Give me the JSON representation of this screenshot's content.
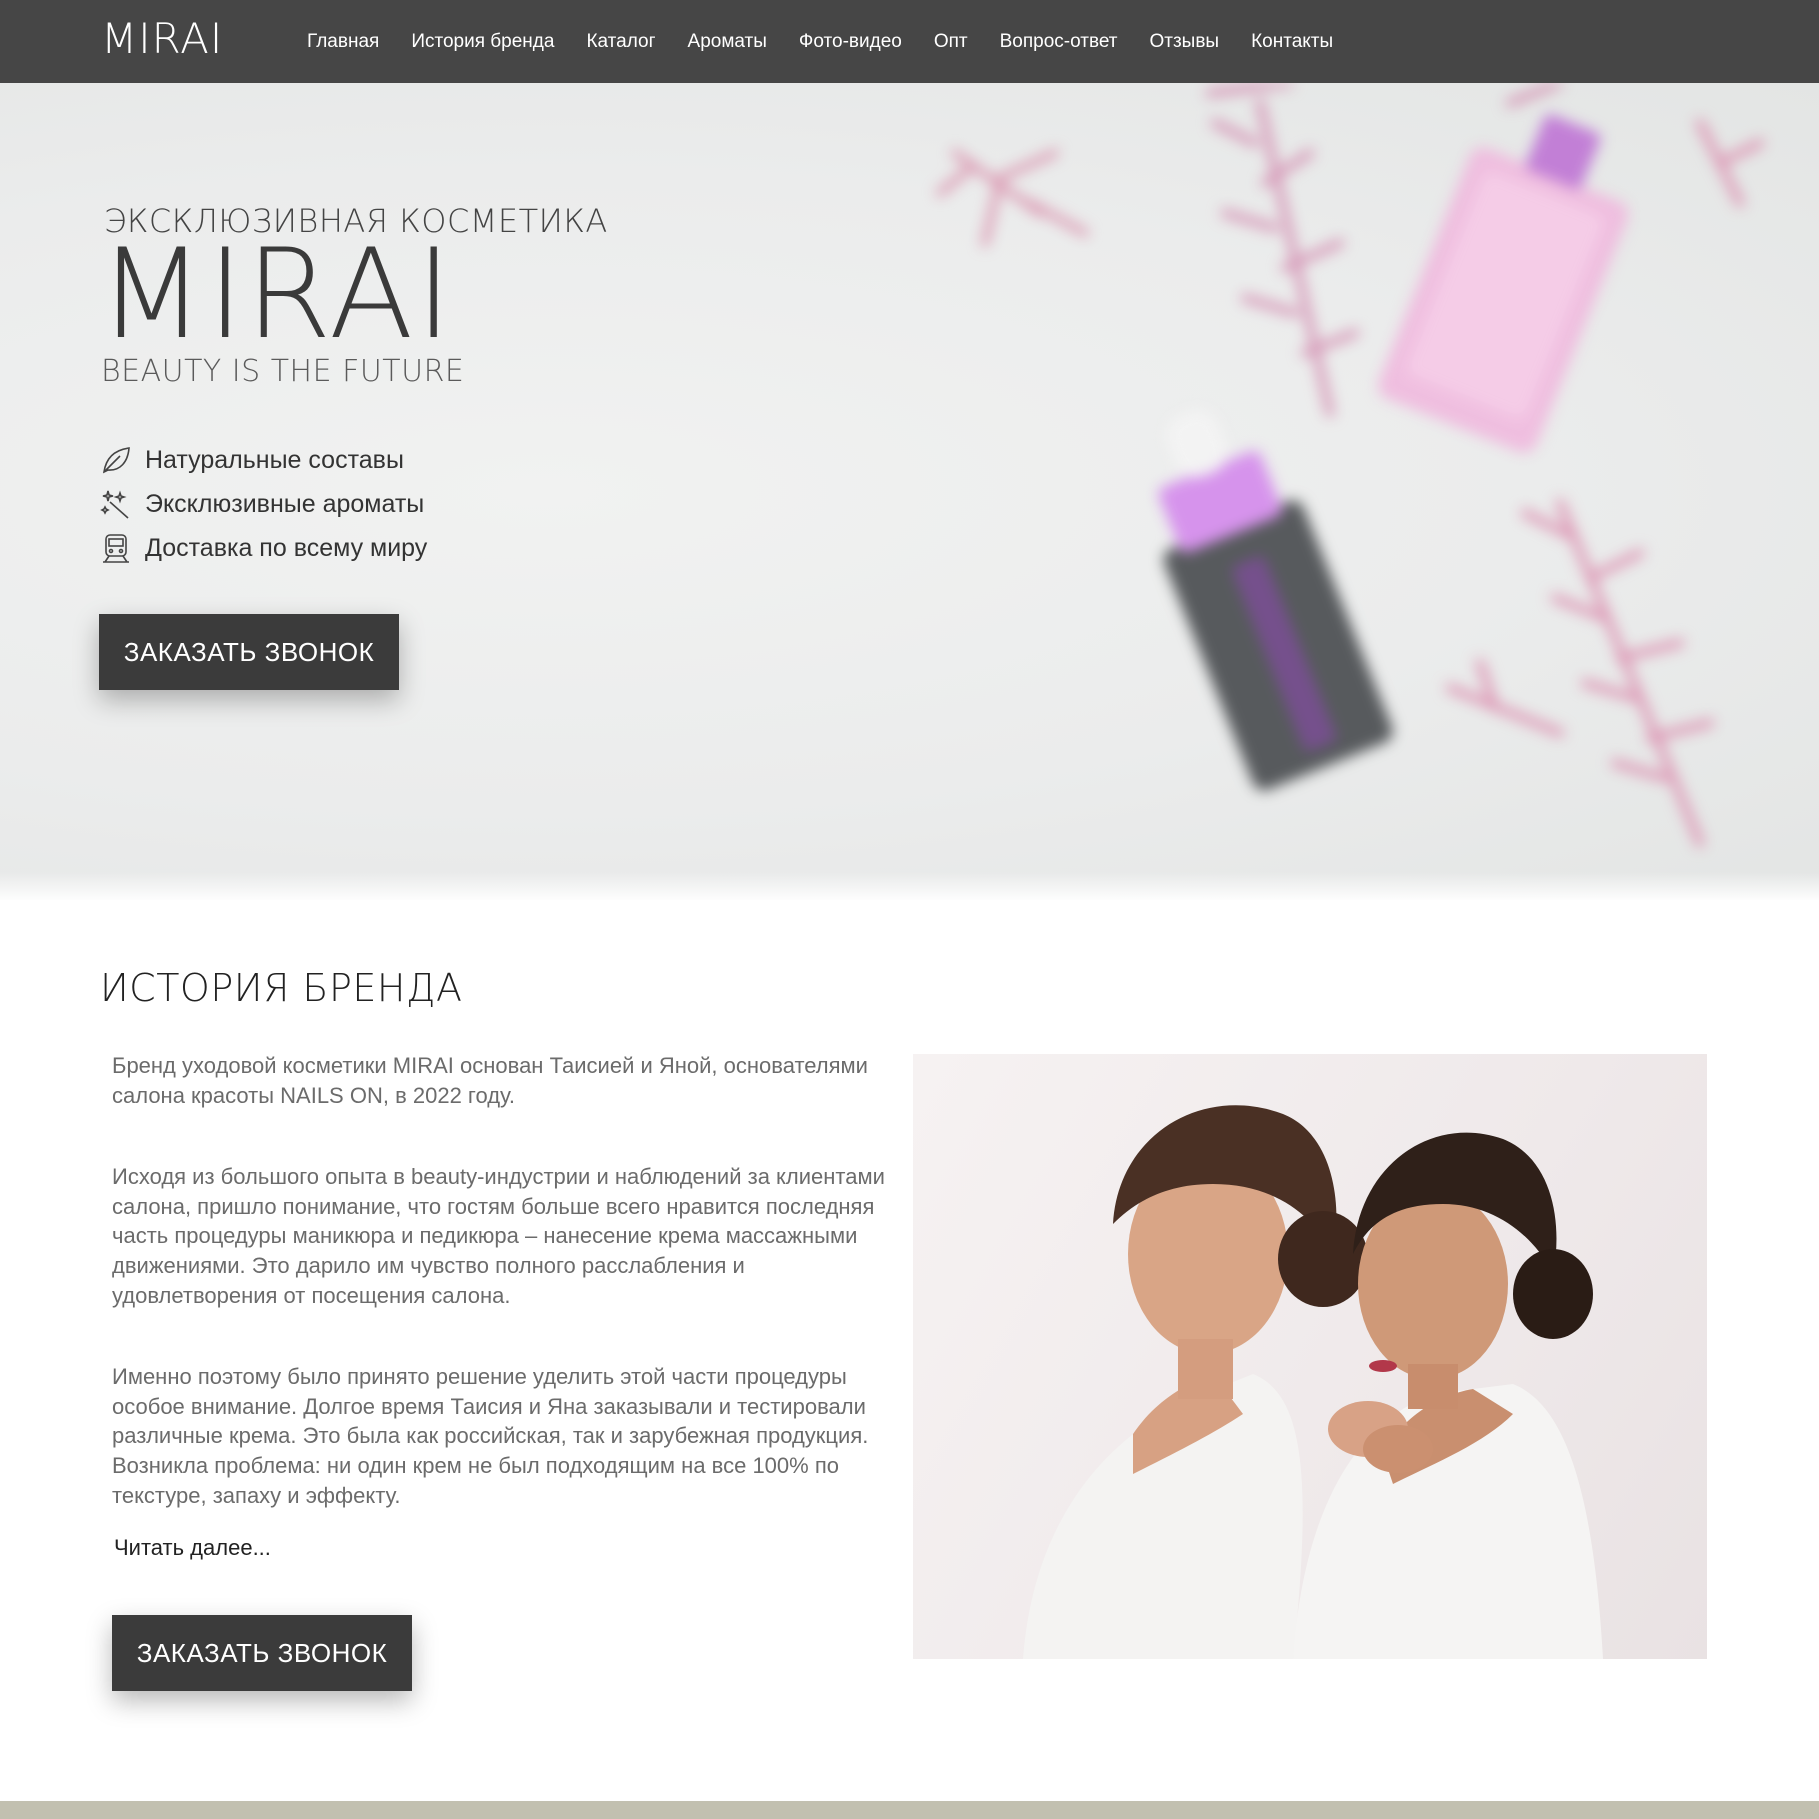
{
  "nav": {
    "logo": "MIRAI",
    "items": [
      {
        "label": "Главная"
      },
      {
        "label": "История бренда"
      },
      {
        "label": "Каталог"
      },
      {
        "label": "Ароматы"
      },
      {
        "label": "Фото-видео"
      },
      {
        "label": "Опт"
      },
      {
        "label": "Вопрос-ответ"
      },
      {
        "label": "Отзывы"
      },
      {
        "label": "Контакты"
      }
    ]
  },
  "hero": {
    "kicker": "ЭКСКЛЮЗИВНАЯ КОСМЕТИКА",
    "title": "MIRAI",
    "tagline": "BEAUTY IS THE FUTURE",
    "features": [
      {
        "icon": "leaf-icon",
        "text": "Натуральные составы"
      },
      {
        "icon": "sparkles-icon",
        "text": "Эксклюзивные ароматы"
      },
      {
        "icon": "train-icon",
        "text": "Доставка по всему миру"
      }
    ],
    "cta_label": "ЗАКАЗАТЬ ЗВОНОК"
  },
  "history": {
    "title": "ИСТОРИЯ БРЕНДА",
    "paragraphs": [
      "Бренд уходовой косметики MIRAI основан Таисией и Яной, основателями салона красоты NAILS ON, в 2022 году.",
      "Исходя из большого опыта в beauty-индустрии и наблюдений за клиентами салона, пришло понимание, что гостям больше всего нравится последняя часть процедуры маникюра и педикюра – нанесение крема массажными движениями. Это дарило им чувство полного расслабления и удовлетворения от посещения салона.",
      "Именно поэтому было принято решение уделить этой части процедуры особое внимание. Долгое время Таисия и Яна заказывали и тестировали различные крема. Это была как российская, так и зарубежная продукция. Возникла проблема: ни один крем не был подходящим на все 100% по текстуре, запаху и эффекту."
    ],
    "read_more": "Читать далее...",
    "cta_label": "ЗАКАЗАТЬ ЗВОНОК"
  },
  "colors": {
    "nav_bg": "#464646",
    "button_bg": "#3b3b3b",
    "accent_pink": "#d98bb3",
    "accent_purple": "#c88ce0",
    "footer_strip": "#c2c0b0"
  }
}
